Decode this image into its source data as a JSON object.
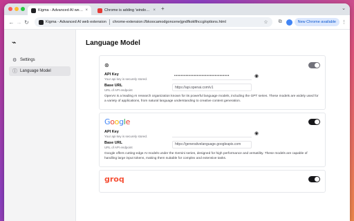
{
  "browser": {
    "tabs": [
      {
        "title": "Kigma - Advanced AI web e",
        "active": true
      },
      {
        "title": "Chrome is adding 'window.ai'",
        "active": false
      }
    ],
    "tab_close": "×",
    "new_tab": "+",
    "tab_overflow": "⌄",
    "omnibox": {
      "site_name": "Kigma - Advanced AI web extension",
      "url": "chrome-extension://bkoocamodgoncene|gndfkokfihccg/options.html"
    },
    "new_chrome_label": "New Chrome available",
    "icons": {
      "back": "←",
      "forward": "→",
      "reload": "↻",
      "star": "☆",
      "extension": "⧉",
      "menu": "⋮"
    }
  },
  "sidebar": {
    "logo_glyph": "⌁",
    "items": [
      {
        "label": "Settings",
        "icon": "⚙",
        "active": false
      },
      {
        "label": "Language Model",
        "icon": "ⓘ",
        "active": true
      }
    ]
  },
  "page": {
    "title": "Language Model"
  },
  "providers": [
    {
      "logo": "⊛",
      "enabled": false,
      "fields": [
        {
          "label": "API Key",
          "hint": "Your api key is securely stored.",
          "value": "••••••••••••••••••••••••••••••••••",
          "type": "password"
        },
        {
          "label": "Base URL",
          "hint": "URL of API endpoint",
          "value": "https://api.openai.com/v1",
          "type": "text"
        }
      ],
      "description": "OpenAI is a leading AI research organization known for its powerful language models, including the GPT series. These models are widely used for a variety of applications, from natural language understanding to creative content generation."
    },
    {
      "logo": "Google",
      "enabled": true,
      "fields": [
        {
          "label": "API Key",
          "hint": "Your api key is securely stored.",
          "value": "",
          "type": "password"
        },
        {
          "label": "Base URL",
          "hint": "URL of API endpoint",
          "value": "https://generativelanguage.googleapis.com",
          "type": "text"
        }
      ],
      "description": "Google offers cutting-edge AI models under the Gemini series, designed for high performance and versatility. These models are capable of handling large input tokens, making them suitable for complex and extensive tasks."
    },
    {
      "logo": "groq",
      "enabled": true
    }
  ],
  "colors": {
    "accent": "#18181b",
    "groq": "#f55036",
    "new_chrome_bg": "#dbe7fd",
    "new_chrome_text": "#0b57d0"
  }
}
